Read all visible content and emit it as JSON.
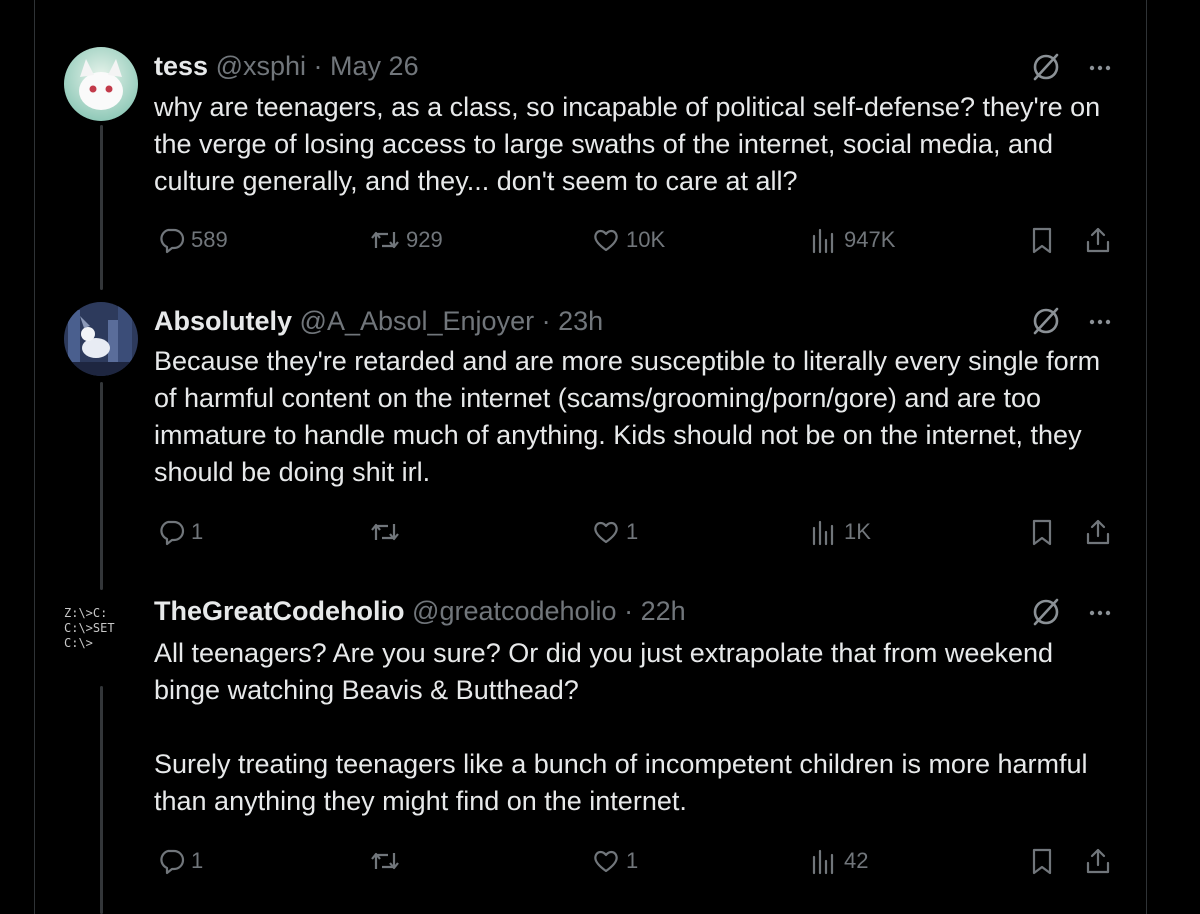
{
  "tweets": [
    {
      "name": "tess",
      "handle": "@xsphi",
      "separator": "·",
      "time": "May 26",
      "text": "why are teenagers, as a class, so incapable of political self-defense? they're on the verge of losing access to large swaths of the internet, social media, and culture generally, and they... don't seem to care at all?",
      "replies": "589",
      "reposts": "929",
      "likes": "10K",
      "views": "947K"
    },
    {
      "name": "Absolutely",
      "handle": "@A_Absol_Enjoyer",
      "separator": "·",
      "time": "23h",
      "text": "Because they're retarded and are more susceptible to literally every single form of harmful content on the internet (scams/grooming/porn/gore) and are too immature to handle much of anything. Kids should not be on the internet, they should be doing shit irl.",
      "replies": "1",
      "reposts": "",
      "likes": "1",
      "views": "1K"
    },
    {
      "name": "TheGreatCodeholio",
      "handle": "@greatcodeholio",
      "separator": "·",
      "time": "22h",
      "text": "All teenagers? Are you sure? Or did you just extrapolate that from weekend binge watching Beavis & Butthead?\n\nSurely treating teenagers like a bunch of incompetent children is more harmful than anything they might find on the internet.",
      "replies": "1",
      "reposts": "",
      "likes": "1",
      "views": "42",
      "avatar_text": [
        "Z:\\>C:",
        "C:\\>SET",
        "C:\\>"
      ]
    }
  ],
  "icons": {
    "reply": "reply-icon",
    "repost": "repost-icon",
    "like": "like-icon",
    "views": "views-icon",
    "bookmark": "bookmark-icon",
    "share": "share-icon",
    "grok": "grok-icon",
    "more": "more-icon"
  },
  "colors": {
    "background": "#000000",
    "text": "#e7e9ea",
    "muted": "#71767b",
    "border": "#2f3336"
  }
}
